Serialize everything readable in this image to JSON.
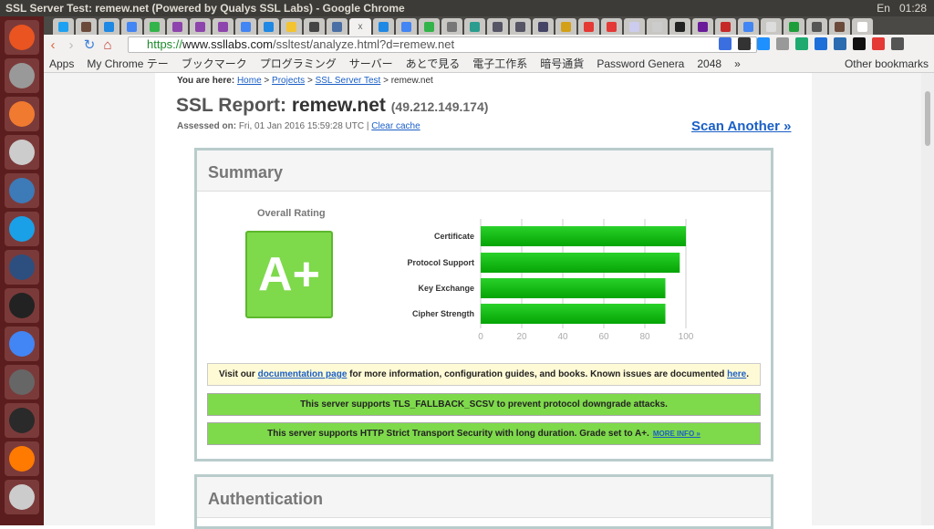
{
  "window": {
    "title": "SSL Server Test: remew.net (Powered by Qualys SSL Labs) - Google Chrome",
    "lang": "En",
    "time": "01:28"
  },
  "browser": {
    "url_scheme": "https://",
    "url_host": "www.ssllabs.com",
    "url_path": "/ssltest/analyze.html?d=remew.net",
    "active_tab_close": "x",
    "tab_colors": [
      "#1da1f2",
      "#6b4a3a",
      "#1e88e5",
      "#4285f4",
      "#33b44a",
      "#8e44ad",
      "#8e44ad",
      "#8e44ad",
      "#4285f4",
      "#1e88e5",
      "#f4c430",
      "#444",
      "#4a6fa5",
      "#fff",
      "#1e88e5",
      "#4285f4",
      "#33b44a",
      "#777",
      "#2a9d8f",
      "#556",
      "#556",
      "#446",
      "#d4a017",
      "#e53935",
      "#e53935",
      "#cce",
      "#ccc",
      "#222",
      "#6a1b9a",
      "#c62828",
      "#4285f4",
      "#ddd",
      "#1e9e3a",
      "#555",
      "#6b4a3a",
      "#fff"
    ],
    "ext_colors": [
      "#3b6fe0",
      "#333",
      "#1e90ff",
      "#999",
      "#1faa70",
      "#1e6fd9",
      "#2b6cb0",
      "#111",
      "#e53935",
      "#555"
    ]
  },
  "bookmarks": {
    "items": [
      "Apps",
      "My Chrome テー",
      "ブックマーク",
      "プログラミング",
      "サーバー",
      "あとで見る",
      "電子工作系",
      "暗号通貨",
      "Password Genera",
      "2048",
      "»"
    ],
    "other": "Other bookmarks"
  },
  "launcher": {
    "icons": [
      "ubuntu",
      "files",
      "software-center",
      "system-settings",
      "jetbrains",
      "skype",
      "virtualbox",
      "terminal",
      "chrome",
      "gimp",
      "system-monitor",
      "firefox",
      "trash"
    ],
    "colors": [
      "#e95420",
      "#999",
      "#f07a30",
      "#ccc",
      "#3d7ab8",
      "#1aa0e6",
      "#2d4f7f",
      "#222",
      "#4285f4",
      "#666",
      "#2a2a2a",
      "#ff7a00",
      "#ccc"
    ]
  },
  "breadcrumb": {
    "label": "You are here:",
    "items": [
      "Home",
      "Projects",
      "SSL Server Test"
    ],
    "current": "remew.net",
    "sep": ">"
  },
  "report": {
    "title_prefix": "SSL Report:",
    "host": "remew.net",
    "ip": "(49.212.149.174)",
    "assessed_label": "Assessed on:",
    "assessed_value": "Fri, 01 Jan 2016 15:59:28 UTC |",
    "clear_cache": "Clear cache",
    "scan_another": "Scan Another »"
  },
  "summary": {
    "title": "Summary",
    "overall_label": "Overall Rating",
    "grade": "A+",
    "grade_color": "#7ed94b",
    "notes": {
      "doc_pre": "Visit our",
      "doc_link": "documentation page",
      "doc_mid": "for more information, configuration guides, and books. Known issues are documented",
      "doc_here": "here",
      "doc_end": ".",
      "fallback": "This server supports TLS_FALLBACK_SCSV to prevent protocol downgrade attacks.",
      "hsts": "This server supports HTTP Strict Transport Security with long duration. Grade set to A+.",
      "more_info": "MORE INFO »"
    }
  },
  "chart_data": {
    "type": "bar",
    "orientation": "horizontal",
    "categories": [
      "Certificate",
      "Protocol Support",
      "Key Exchange",
      "Cipher Strength"
    ],
    "values": [
      100,
      97,
      90,
      90
    ],
    "xlim": [
      0,
      100
    ],
    "ticks": [
      0,
      20,
      40,
      60,
      80,
      100
    ],
    "grid": true,
    "color": "#1ec31e"
  },
  "auth": {
    "title": "Authentication"
  }
}
